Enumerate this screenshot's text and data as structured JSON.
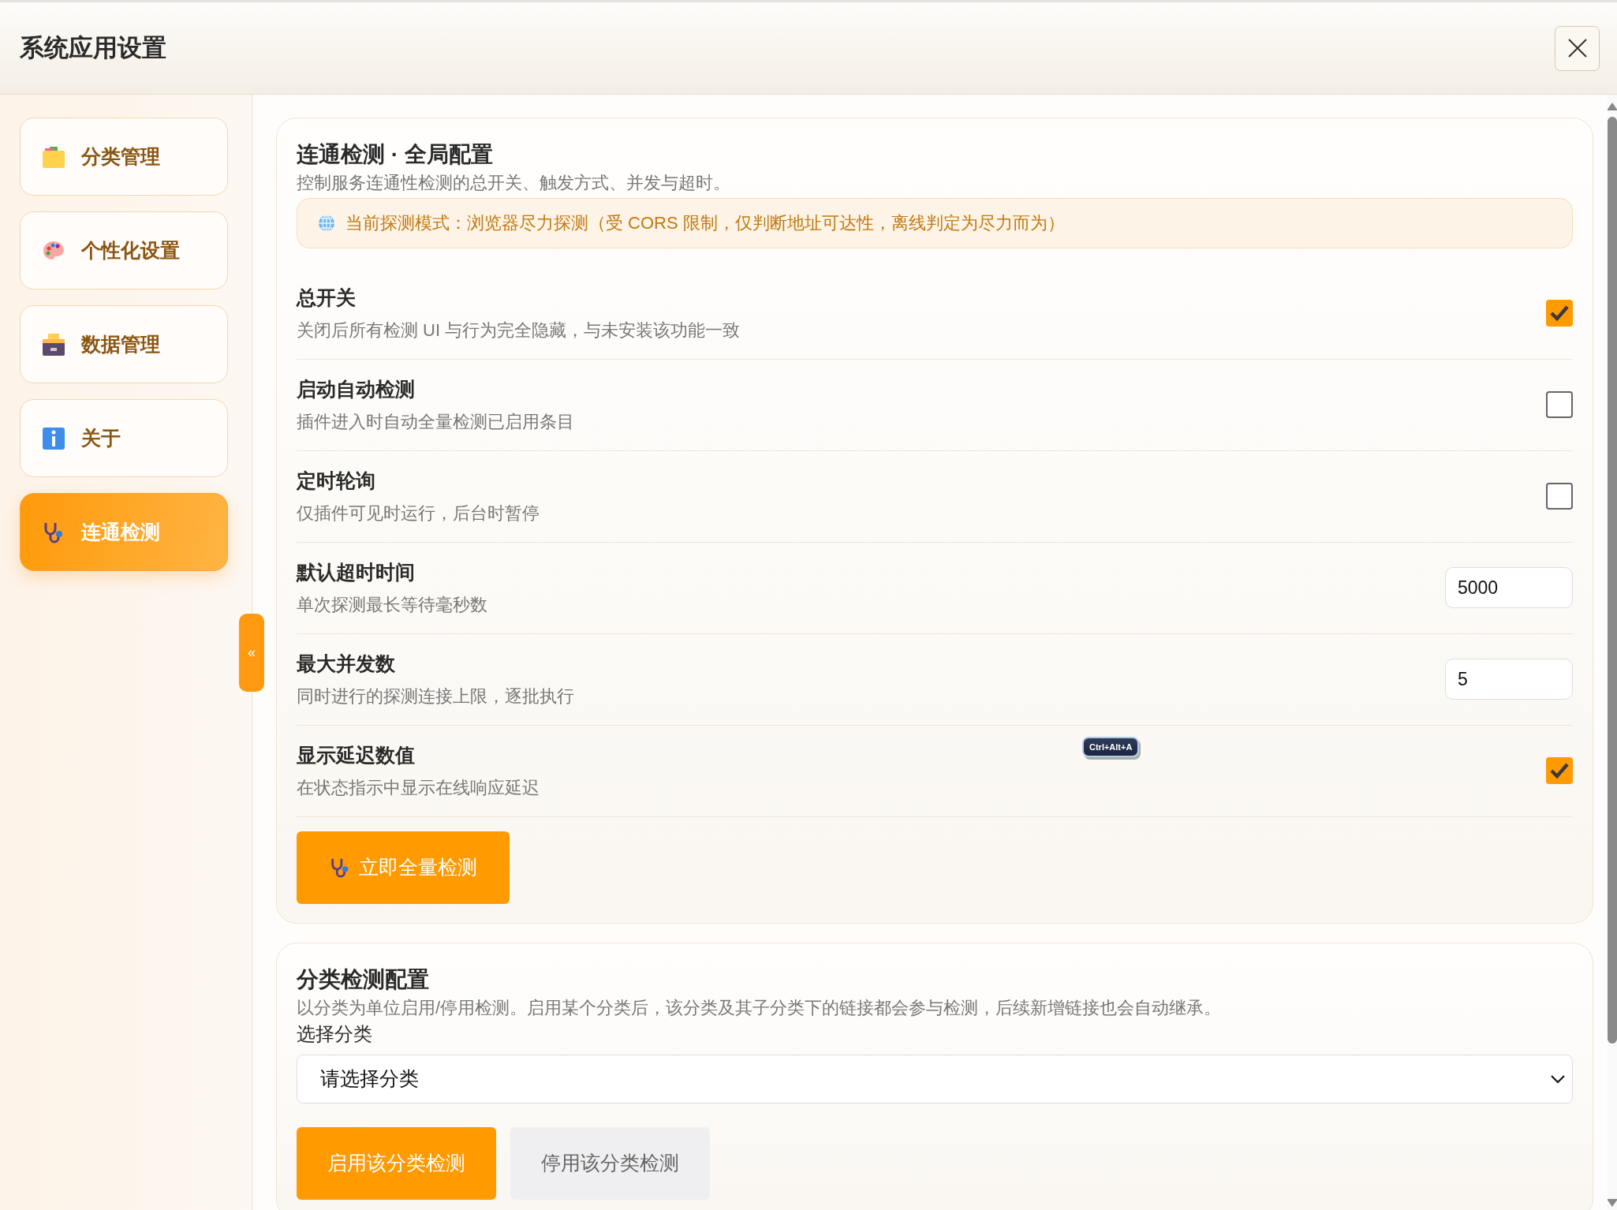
{
  "window": {
    "title": "系统应用设置"
  },
  "sidebar": {
    "items": [
      {
        "label": "分类管理",
        "selected": false
      },
      {
        "label": "个性化设置",
        "selected": false
      },
      {
        "label": "数据管理",
        "selected": false
      },
      {
        "label": "关于",
        "selected": false
      },
      {
        "label": "连通检测",
        "selected": true
      }
    ],
    "collapse": "«"
  },
  "sections": [
    {
      "title": "连通检测 · 全局配置",
      "description": "控制服务连通性检测的总开关、触发方式、并发与超时。",
      "notice": "当前探测模式：浏览器尽力探测（受 CORS 限制，仅判断地址可达性，离线判定为尽力而为）",
      "settings": [
        {
          "kind": "checkbox",
          "title": "总开关",
          "description": "关闭后所有检测 UI 与行为完全隐藏，与未安装该功能一致",
          "checked": true
        },
        {
          "kind": "checkbox",
          "title": "启动自动检测",
          "description": "插件进入时自动全量检测已启用条目",
          "checked": false
        },
        {
          "kind": "checkbox",
          "title": "定时轮询",
          "description": "仅插件可见时运行，后台时暂停",
          "checked": false
        },
        {
          "kind": "number",
          "title": "默认超时时间",
          "description": "单次探测最长等待毫秒数",
          "value": "5000"
        },
        {
          "kind": "number",
          "title": "最大并发数",
          "description": "同时进行的探测连接上限，逐批执行",
          "value": "5"
        },
        {
          "kind": "checkbox",
          "title": "显示延迟数值",
          "description": "在状态指示中显示在线响应延迟",
          "checked": true
        }
      ],
      "action_button": "立即全量检测"
    },
    {
      "title": "分类检测配置",
      "description": "以分类为单位启用/停用检测。启用某个分类后，该分类及其子分类下的链接都会参与检测，后续新增链接也会自动继承。",
      "select_label": "选择分类",
      "select_value": "请选择分类",
      "buttons": [
        {
          "label": "启用该分类检测",
          "kind": "primary"
        },
        {
          "label": "停用该分类检测",
          "kind": "secondary"
        }
      ]
    }
  ],
  "shortcut_badge": "Ctrl+Alt+A"
}
